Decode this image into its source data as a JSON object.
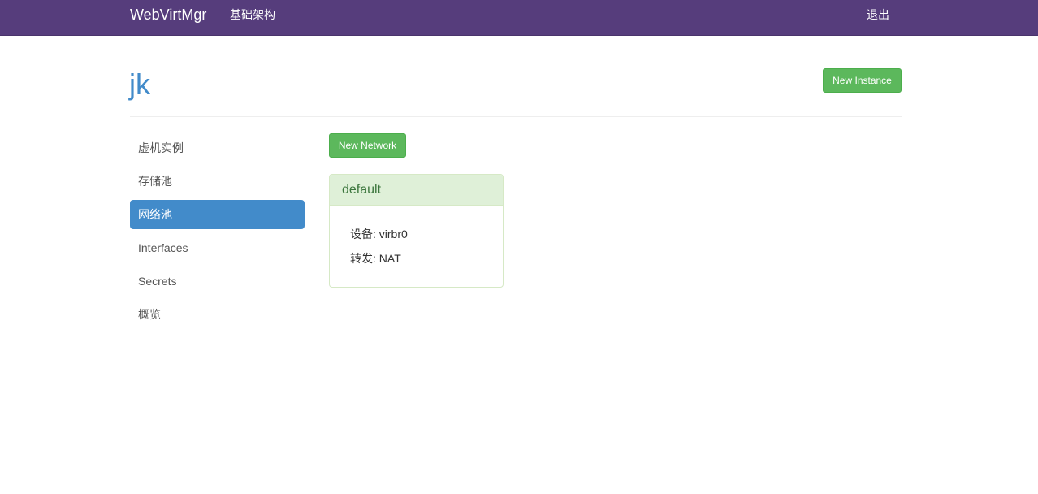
{
  "navbar": {
    "brand": "WebVirtMgr",
    "infrastructure": "基础架构",
    "logout": "退出"
  },
  "page": {
    "title": "jk",
    "new_instance": "New Instance",
    "new_network": "New Network"
  },
  "sidebar": {
    "items": [
      {
        "label": "虚机实例",
        "active": false
      },
      {
        "label": "存储池",
        "active": false
      },
      {
        "label": "网络池",
        "active": true
      },
      {
        "label": "Interfaces",
        "active": false
      },
      {
        "label": "Secrets",
        "active": false
      },
      {
        "label": "概览",
        "active": false
      }
    ]
  },
  "network": {
    "name": "default",
    "device": "设备: virbr0",
    "forward": "转发: NAT"
  },
  "colors": {
    "navbar": "#563d7c",
    "accent": "#428bca",
    "success": "#5cb85c",
    "panel_heading": "#dff0d8"
  }
}
